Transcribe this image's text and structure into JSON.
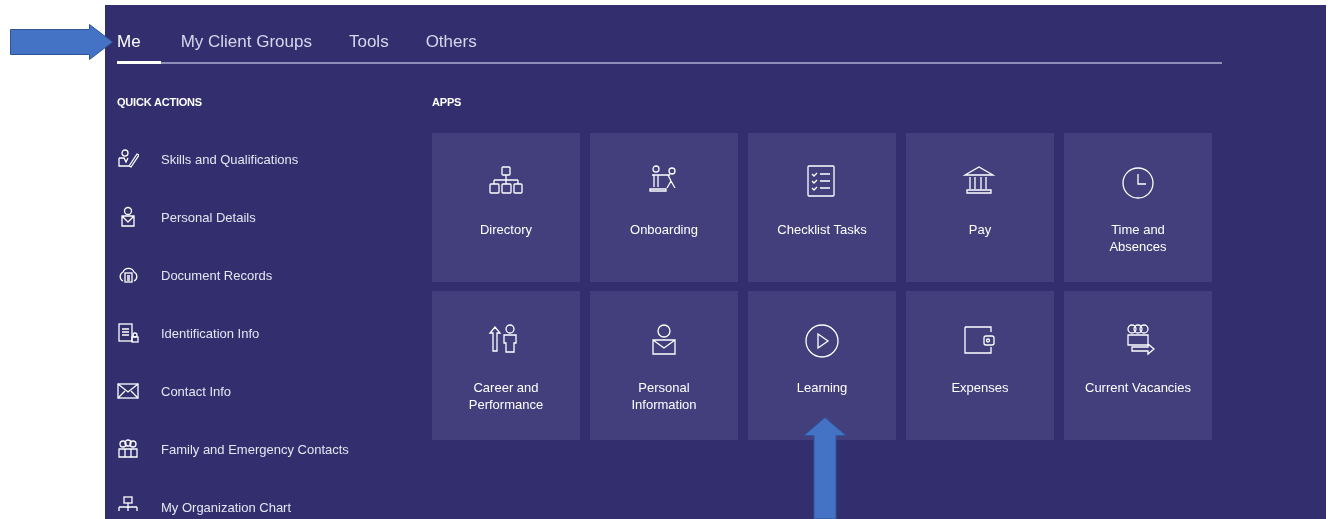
{
  "tabs": [
    {
      "label": "Me",
      "selected": true
    },
    {
      "label": "My Client Groups",
      "selected": false
    },
    {
      "label": "Tools",
      "selected": false
    },
    {
      "label": "Others",
      "selected": false
    }
  ],
  "quick_actions": {
    "title": "QUICK ACTIONS",
    "items": [
      {
        "label": "Skills and Qualifications"
      },
      {
        "label": "Personal Details"
      },
      {
        "label": "Document Records"
      },
      {
        "label": "Identification Info"
      },
      {
        "label": "Contact Info"
      },
      {
        "label": "Family and Emergency Contacts"
      },
      {
        "label": "My Organization Chart"
      }
    ]
  },
  "apps": {
    "title": "APPS",
    "tiles": [
      {
        "label": "Directory"
      },
      {
        "label": "Onboarding"
      },
      {
        "label": "Checklist Tasks"
      },
      {
        "label": "Pay"
      },
      {
        "label": "Time and\nAbsences"
      },
      {
        "label": "Career and\nPerformance"
      },
      {
        "label": "Personal\nInformation"
      },
      {
        "label": "Learning"
      },
      {
        "label": "Expenses"
      },
      {
        "label": "Current Vacancies"
      }
    ]
  }
}
